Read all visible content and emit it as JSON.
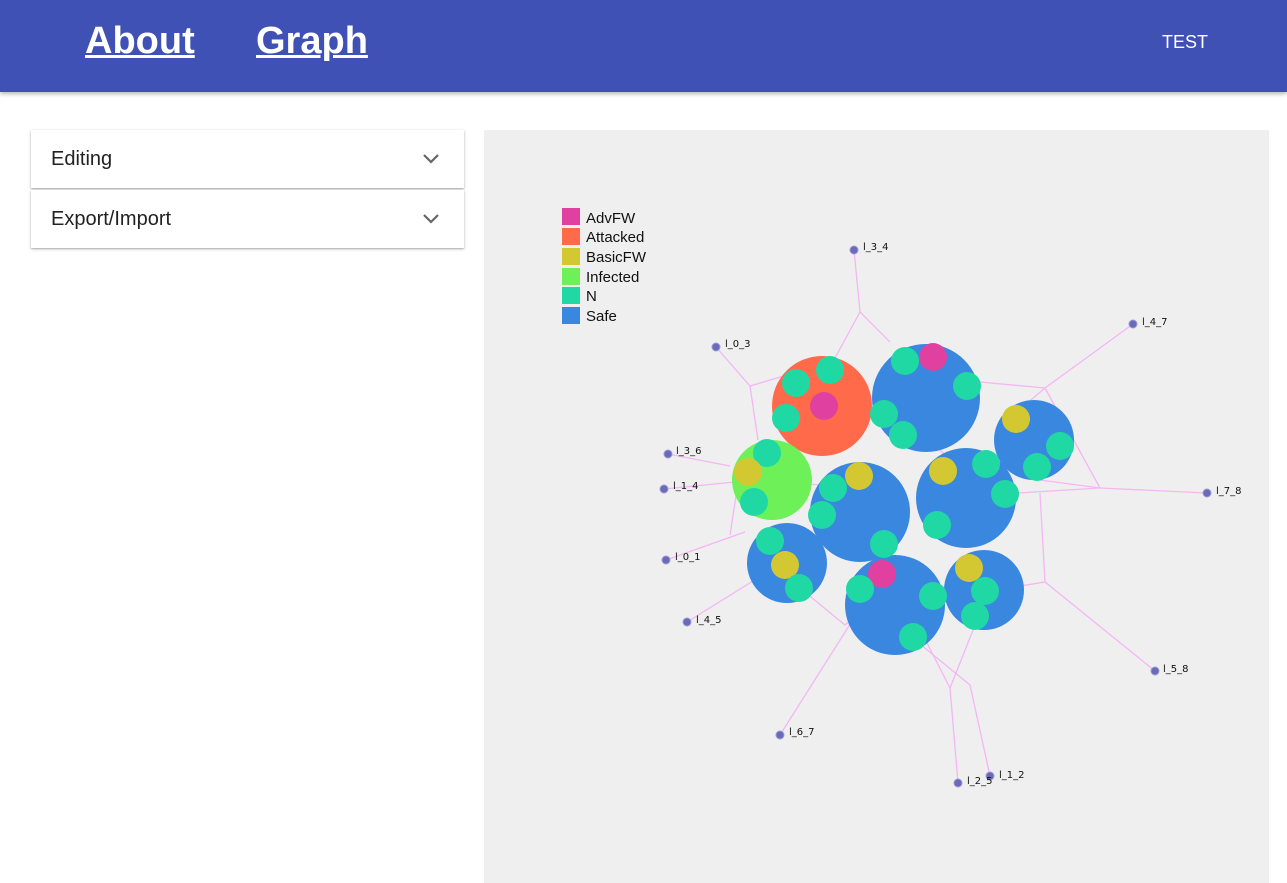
{
  "nav": {
    "about": "About",
    "graph": "Graph",
    "user": "TEST"
  },
  "accordion": {
    "editing": "Editing",
    "export_import": "Export/Import"
  },
  "legend": [
    {
      "label": "AdvFW",
      "color": "#e040a0"
    },
    {
      "label": "Attacked",
      "color": "#ff6b4a"
    },
    {
      "label": "BasicFW",
      "color": "#d4c832"
    },
    {
      "label": "Infected",
      "color": "#6ef058"
    },
    {
      "label": "N",
      "color": "#1fd8a4"
    },
    {
      "label": "Safe",
      "color": "#3a87e0"
    }
  ],
  "links": [
    "l_3_4",
    "l_4_7",
    "l_0_3",
    "l_3_6",
    "l_1_4",
    "l_7_8",
    "l_0_1",
    "l_4_5",
    "l_5_8",
    "l_6_7",
    "l_2_5",
    "l_1_2"
  ],
  "colors": {
    "appbar": "#3f51b5",
    "link_line": "#f4b6f4",
    "endpoint": "#6a6ab8"
  }
}
